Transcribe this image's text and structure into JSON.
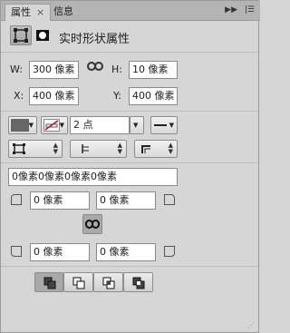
{
  "tabs": [
    {
      "label": "属性",
      "closable": true
    },
    {
      "label": "信息"
    }
  ],
  "header": {
    "title": "实时形状属性"
  },
  "size": {
    "w_label": "W:",
    "w_value": "300 像素",
    "h_label": "H:",
    "h_value": "10 像素"
  },
  "position": {
    "x_label": "X:",
    "x_value": "400 像素",
    "y_label": "Y:",
    "y_value": "400 像素"
  },
  "stroke": {
    "width_value": "2 点",
    "fill_color": "#666666"
  },
  "corners": {
    "all_value": "0像素0像素0像素0像素",
    "top_left": "0 像素",
    "top_right": "0 像素",
    "bottom_left": "0 像素",
    "bottom_right": "0 像素"
  }
}
